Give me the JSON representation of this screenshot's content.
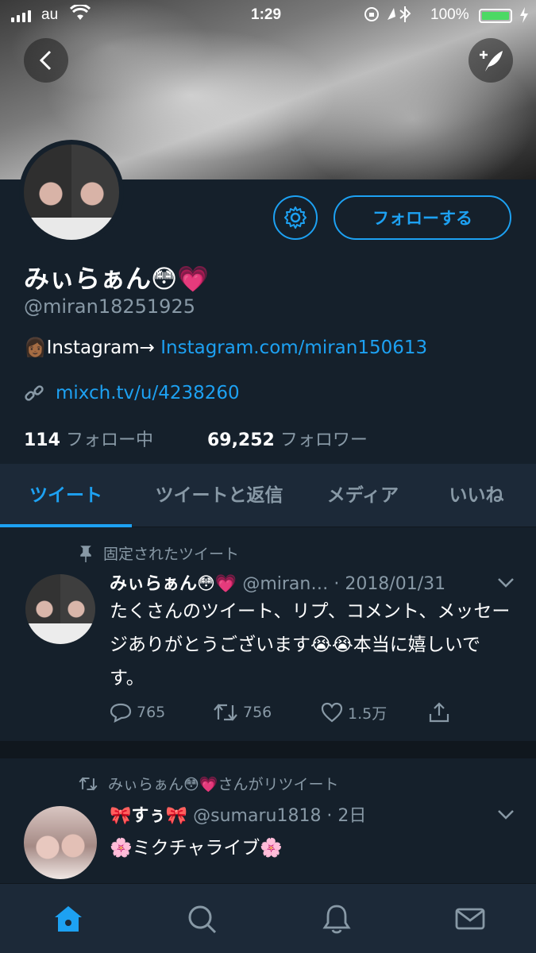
{
  "status_bar": {
    "carrier": "au",
    "time": "1:29",
    "battery": "100%"
  },
  "profile": {
    "name": "みぃらぁん😳💗",
    "handle": "@miran18251925",
    "bio_prefix": "👩🏾Instagram→ ",
    "bio_link": "Instagram.com/miran150613",
    "website": "mixch.tv/u/4238260",
    "following_count": "114",
    "following_label": "フォロー中",
    "followers_count": "69,252",
    "followers_label": "フォロワー",
    "follow_button": "フォローする"
  },
  "tabs": [
    {
      "label": "ツイート",
      "active": true
    },
    {
      "label": "ツイートと返信",
      "active": false
    },
    {
      "label": "メディア",
      "active": false
    },
    {
      "label": "いいね",
      "active": false
    }
  ],
  "tweets": [
    {
      "context": "固定されたツイート",
      "name": "みぃらぁん😳💗",
      "handle_date": "@miran… · 2018/01/31",
      "text": "たくさんのツイート、リプ、コメント、メッセージありがとうございます😭😭本当に嬉しいです。",
      "replies": "765",
      "retweets": "756",
      "likes": "1.5万"
    },
    {
      "context": "みぃらぁん😳💗さんがリツイート",
      "name": "🎀すぅ🎀",
      "handle_date": "@sumaru1818 · 2日",
      "text": "🌸ミクチャライブ🌸"
    }
  ],
  "colors": {
    "accent": "#1da1f2",
    "background": "#15202b",
    "muted": "#8899a6"
  },
  "icons": [
    "back-arrow-icon",
    "compose-icon",
    "gear-icon",
    "link-icon",
    "pin-icon",
    "retweet-icon",
    "reply-icon",
    "like-icon",
    "share-icon",
    "chevron-down-icon",
    "home-icon",
    "search-icon",
    "bell-icon",
    "mail-icon"
  ]
}
